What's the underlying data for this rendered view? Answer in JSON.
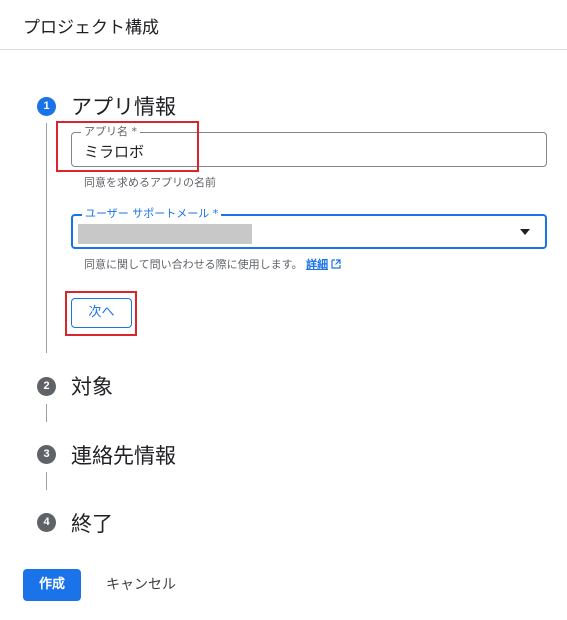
{
  "header": {
    "title": "プロジェクト構成"
  },
  "steps": [
    {
      "number": "1",
      "title": "アプリ情報"
    },
    {
      "number": "2",
      "title": "対象"
    },
    {
      "number": "3",
      "title": "連絡先情報"
    },
    {
      "number": "4",
      "title": "終了"
    }
  ],
  "app_name": {
    "label": "アプリ名 *",
    "value": "ミラロボ",
    "hint": "同意を求めるアプリの名前"
  },
  "support_email": {
    "label": "ユーザー サポートメール *",
    "hint": "同意に関して問い合わせる際に使用します。",
    "link": "詳細"
  },
  "next_button": "次へ",
  "create_button": "作成",
  "cancel_button": "キャンセル",
  "colors": {
    "accent": "#1a73e8",
    "highlight": "#d9262c",
    "inactive_step": "#5f6368"
  }
}
